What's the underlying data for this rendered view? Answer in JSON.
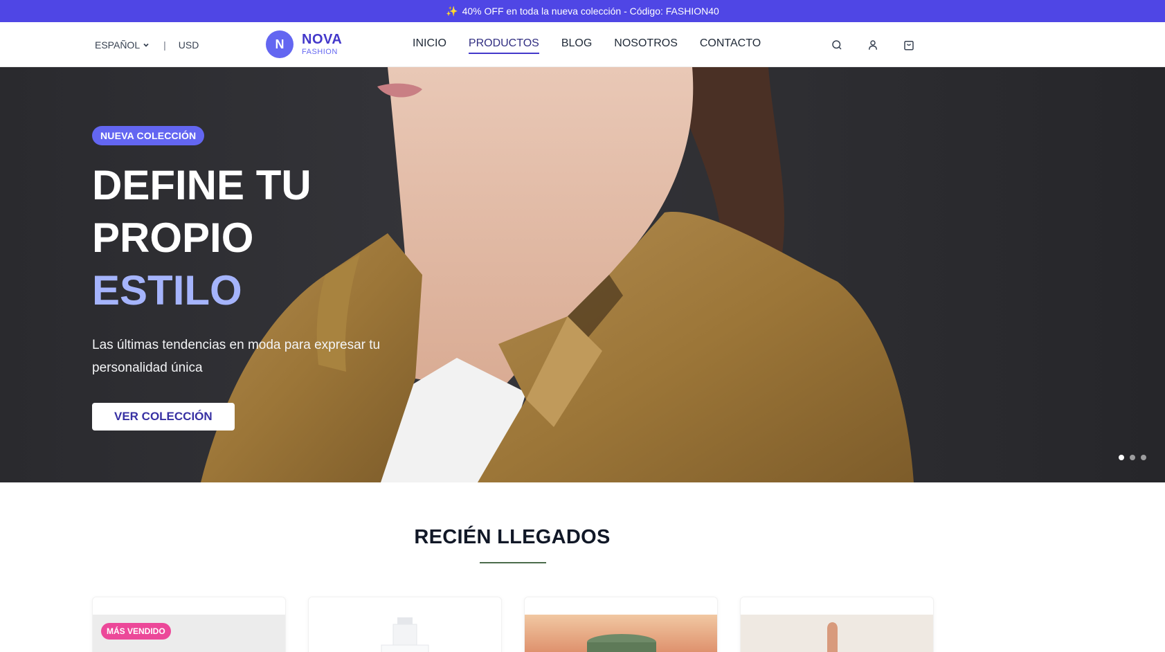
{
  "promo": {
    "icon": "sparkles-icon",
    "text": "40% OFF en toda la nueva colección - Código: FASHION40"
  },
  "header": {
    "language": "ESPAÑOL",
    "currency": "USD",
    "separator": "|",
    "logo": {
      "initial": "N",
      "brand": "NOVA",
      "subtitle": "FASHION"
    },
    "nav": [
      {
        "label": "INICIO",
        "active": false
      },
      {
        "label": "PRODUCTOS",
        "active": true
      },
      {
        "label": "BLOG",
        "active": false
      },
      {
        "label": "NOSOTROS",
        "active": false
      },
      {
        "label": "CONTACTO",
        "active": false
      }
    ],
    "icons": [
      "search-icon",
      "user-icon",
      "shopping-bag-icon"
    ]
  },
  "hero": {
    "badge": "NUEVA COLECCIÓN",
    "title_line1": "DEFINE TU",
    "title_line2": "PROPIO",
    "title_accent": "ESTILO",
    "description": "Las últimas tendencias en moda para expresar tu personalidad única",
    "cta": "VER COLECCIÓN",
    "slides": 3,
    "active_slide": 1
  },
  "section": {
    "title": "RECIÉN LLEGADOS"
  },
  "products": [
    {
      "badge": "MÁS VENDIDO"
    },
    {
      "badge": ""
    },
    {
      "badge": ""
    },
    {
      "badge": ""
    }
  ],
  "colors": {
    "primary": "#4f46e5",
    "accent": "#a5b4fc",
    "badge_pink": "#ec4899",
    "rule_green": "#4b6b4b"
  }
}
